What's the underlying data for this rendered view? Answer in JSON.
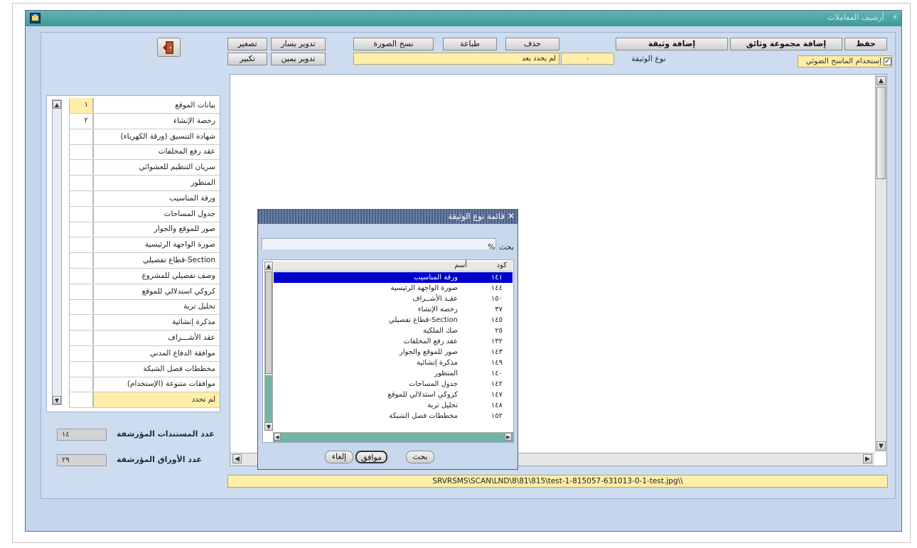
{
  "window": {
    "title": "أرشيف المعاملات"
  },
  "toolbar": {
    "save": "حفظ",
    "add_doc_group": "إضافة مجموعة وثائق",
    "add_doc": "إضافة وثيقة",
    "delete": "حذف",
    "print": "طباعة",
    "copy_image": "نسخ الصورة",
    "rotate_left": "تدوير يسار",
    "zoom_out": "تصغير",
    "rotate_right": "تدوير يمين",
    "zoom_in": "تكبير"
  },
  "options": {
    "use_default_scanner_label": "إستخدام الماسح الضوئي",
    "use_default_scanner_checked": true,
    "doc_type_label": "نوع الوثيقة",
    "doc_type_code": "٠",
    "doc_type_name": "لم يحدد بعد"
  },
  "doc_list": {
    "items": [
      {
        "name": "بيانات الموقع",
        "num": "١",
        "selected": true
      },
      {
        "name": "رخصة الإنشاء",
        "num": "٢"
      },
      {
        "name": "شهادة التنسيق (ورقة الكهرباء)",
        "num": ""
      },
      {
        "name": "عقد رفع المخلفات",
        "num": ""
      },
      {
        "name": "سريان التنظيم للعشوائي",
        "num": ""
      },
      {
        "name": "المنظور",
        "num": ""
      },
      {
        "name": "ورقة المناسيب",
        "num": ""
      },
      {
        "name": "جدول المساحات",
        "num": ""
      },
      {
        "name": "صور للموقع والجوار",
        "num": ""
      },
      {
        "name": "صورة الواجهة الرئيسية",
        "num": ""
      },
      {
        "name": "قطاع تفصيلي-Section",
        "num": ""
      },
      {
        "name": "وصف تفصيلي للمشروع",
        "num": ""
      },
      {
        "name": "كروكي استدلالي للموقع",
        "num": ""
      },
      {
        "name": "تحليل تربة",
        "num": ""
      },
      {
        "name": "مذكرة إنشائية",
        "num": ""
      },
      {
        "name": "عقد الأشـــراف",
        "num": ""
      },
      {
        "name": "موافقة الدفاع المدني",
        "num": ""
      },
      {
        "name": "مخططات فصل الشبكة",
        "num": ""
      },
      {
        "name": "موافقات متنوعة (الإستخدام)",
        "num": ""
      },
      {
        "name": "لم تحدد",
        "num": "",
        "highlight": true
      }
    ]
  },
  "counts": {
    "indexed_docs_label": "عدد المستندات المؤرشفة",
    "indexed_docs_value": "١٤",
    "indexed_pages_label": "عدد الأوراق المؤرشفة",
    "indexed_pages_value": "٢٩"
  },
  "status": {
    "path": "SRVRSMS\\SCAN\\LND\\8\\81\\815\\test-1-815057-631013-0-1-test.jpg\\\\"
  },
  "dialog": {
    "title": "قائمة نوع الوثيقة",
    "search_label": "بحث",
    "search_value": "%",
    "col_code": "كود",
    "col_name": "أسم",
    "rows": [
      {
        "code": "١٤١",
        "name": "ورقة المناسيب",
        "selected": true
      },
      {
        "code": "١٤٤",
        "name": "صورة الواجهة الرئيسية"
      },
      {
        "code": "١٥٠",
        "name": "عقـد الأشــراف"
      },
      {
        "code": "٣٧",
        "name": "رخصة الإنشاء"
      },
      {
        "code": "١٤٥",
        "name": "قطاع تفصيلي-Section"
      },
      {
        "code": "٢٥",
        "name": "صك الملكية"
      },
      {
        "code": "١٣٢",
        "name": "عقد رفع المخلفات"
      },
      {
        "code": "١٤٣",
        "name": "صور للموقع والجوار"
      },
      {
        "code": "١٤٩",
        "name": "مذكرة إنشائية"
      },
      {
        "code": "١٤٠",
        "name": "المنظور"
      },
      {
        "code": "١٤٢",
        "name": "جدول المساحات"
      },
      {
        "code": "١٤٧",
        "name": "كروكي استدلالي للموقع"
      },
      {
        "code": "١٤٨",
        "name": "تحليل تربة"
      },
      {
        "code": "١٥٢",
        "name": "مخططات فصل الشبكة"
      }
    ],
    "btn_search": "بحث",
    "btn_ok": "موافق",
    "btn_cancel": "إلغاء"
  },
  "colors": {
    "accent_title": "#3e9895",
    "field_yellow": "#ffeea8",
    "selection": "#0000cc"
  }
}
